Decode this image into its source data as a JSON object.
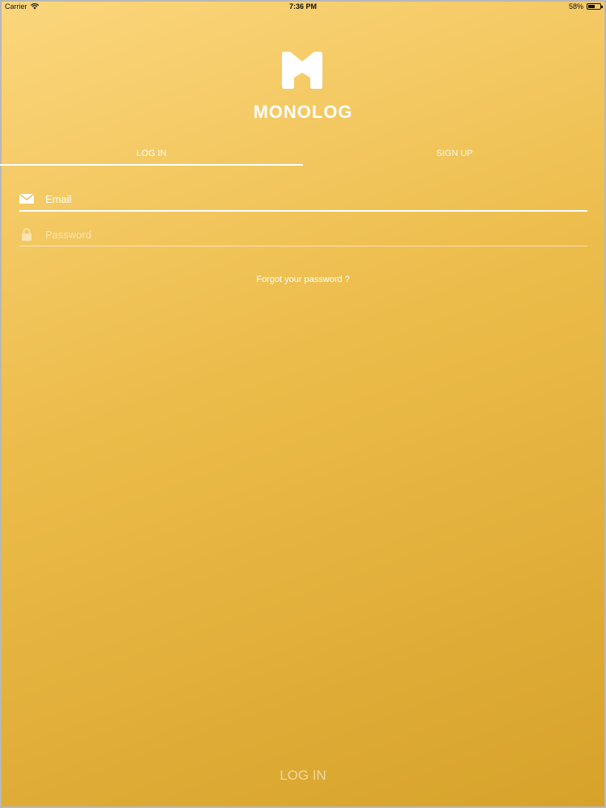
{
  "status_bar": {
    "carrier": "Carrier",
    "time": "7:36 PM",
    "battery_percent": "58%",
    "battery_level": 0.58
  },
  "brand": {
    "name": "MONOLOG",
    "logo_icon": "monolog-m-logo"
  },
  "tabs": [
    {
      "label": "LOG IN",
      "active": true
    },
    {
      "label": "SIGN UP",
      "active": false
    }
  ],
  "form": {
    "email": {
      "placeholder": "Email",
      "value": "",
      "icon": "envelope-icon"
    },
    "password": {
      "placeholder": "Password",
      "value": "",
      "icon": "lock-icon"
    },
    "forgot_label": "Forgot your password ?"
  },
  "actions": {
    "login_label": "LOG IN"
  },
  "colors": {
    "gradient_start": "#fbd67c",
    "gradient_end": "#d6a22a",
    "text": "#ffffff"
  }
}
